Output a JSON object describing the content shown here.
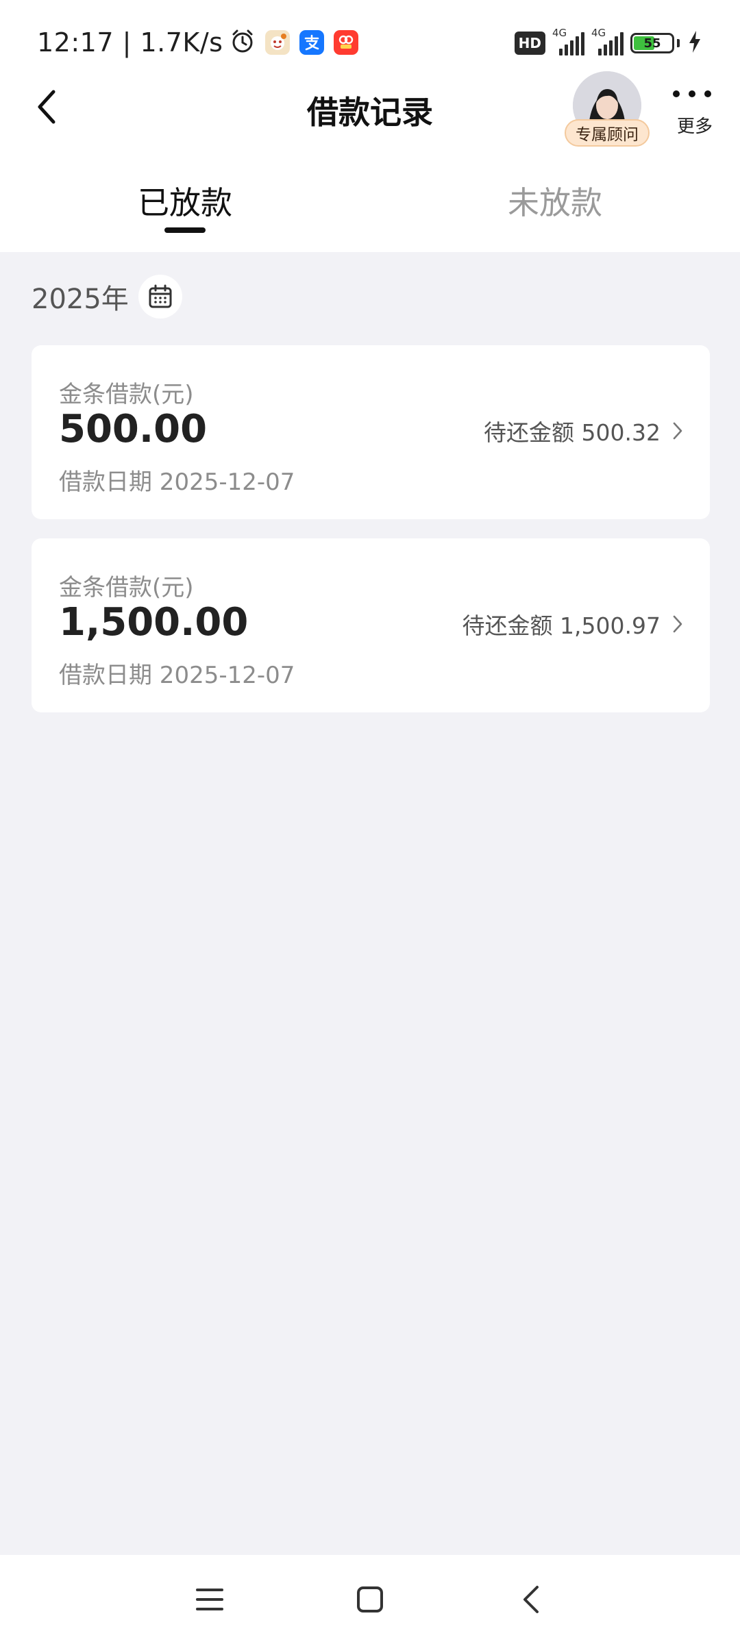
{
  "status_bar": {
    "time": "12:17 | 1.7K/s",
    "icons": [
      "alarm-icon",
      "app-notification-icon",
      "alipay-icon",
      "app-notification-icon"
    ],
    "network_badge": "HD",
    "signal_1_label": "4G",
    "signal_2_label": "4G",
    "battery_level": "55",
    "battery_percent": 55,
    "charging": true
  },
  "header": {
    "title": "借款记录",
    "advisor_label": "专属顾问",
    "more_label": "更多"
  },
  "tabs": [
    {
      "label": "已放款",
      "active": true
    },
    {
      "label": "未放款",
      "active": false
    }
  ],
  "year_filter": {
    "label": "2025年",
    "icon": "calendar-icon"
  },
  "loans": [
    {
      "type_label": "金条借款(元)",
      "amount": "500.00",
      "date_text": "借款日期 2025-12-07",
      "due_text": "待还金额 500.32"
    },
    {
      "type_label": "金条借款(元)",
      "amount": "1,500.00",
      "date_text": "借款日期 2025-12-07",
      "due_text": "待还金额 1,500.97"
    }
  ],
  "colors": {
    "page_background": "#f2f2f6",
    "card_background": "#ffffff",
    "text_primary": "#222222",
    "text_secondary": "#8c8c8c",
    "tab_inactive": "#9a9a9a",
    "advisor_badge": "#fde6cf",
    "battery_fill": "#3ec03e"
  },
  "nav_bar": {
    "icons": [
      "menu-icon",
      "home-square-icon",
      "back-chevron-icon"
    ]
  }
}
